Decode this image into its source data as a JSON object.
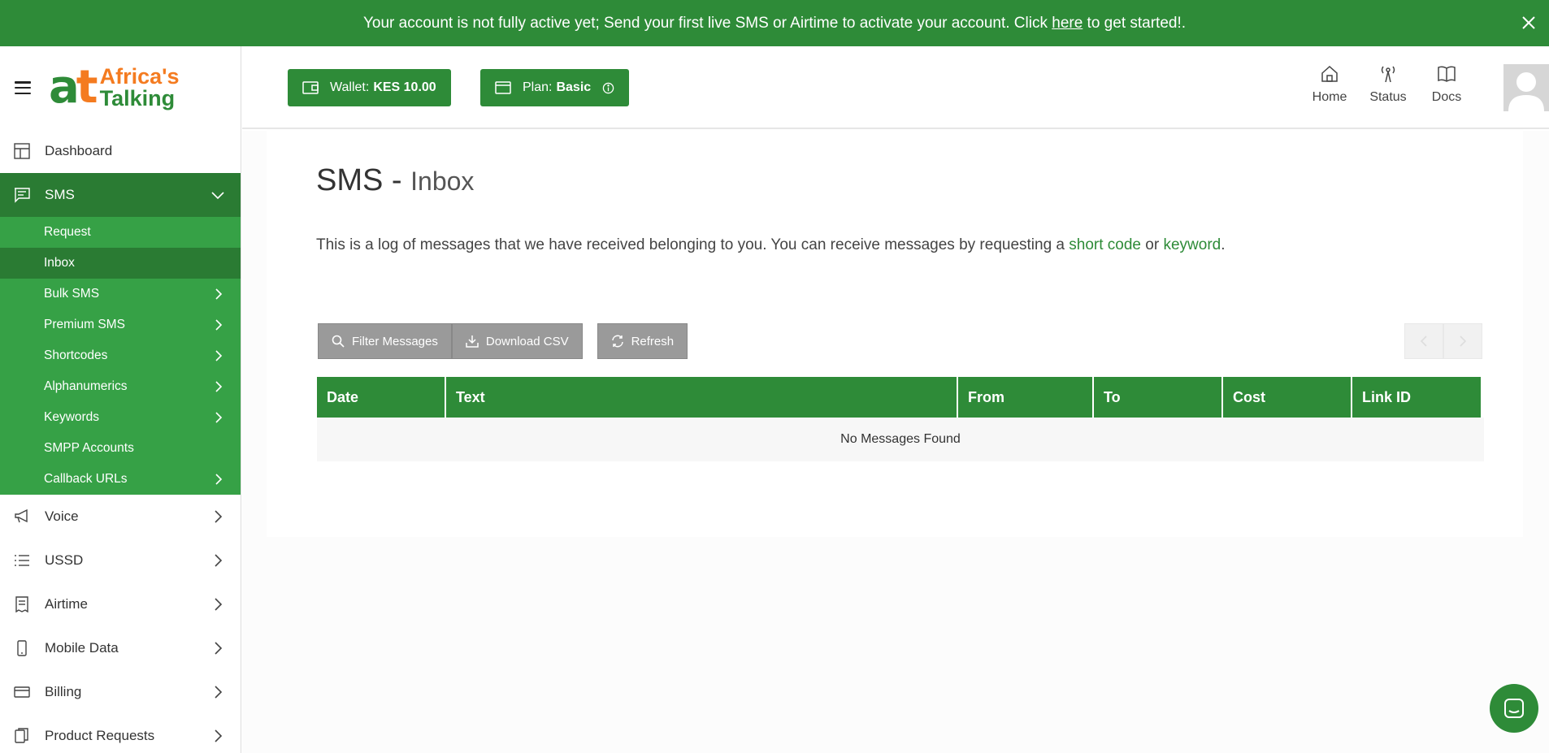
{
  "banner": {
    "text_before": "Your account is not fully active yet; Send your first live SMS or Airtime to activate your account. Click ",
    "link": "here",
    "text_after": " to get started!.",
    "close_icon": "close-icon"
  },
  "brand": {
    "logo_mark_a": "a",
    "logo_mark_t": "t",
    "name_line1": "Africa's",
    "name_line2": "Talking",
    "colors": {
      "green": "#2e8b38",
      "orange": "#f47b20",
      "submenu_green": "#36a146",
      "active_green": "#2a7b33"
    }
  },
  "sidebar": {
    "items_top": [
      {
        "label": "Dashboard",
        "icon": "dashboard-icon"
      },
      {
        "label": "SMS",
        "icon": "message-icon"
      }
    ],
    "sms_submenu": [
      {
        "label": "Request"
      },
      {
        "label": "Inbox"
      },
      {
        "label": "Bulk SMS"
      },
      {
        "label": "Premium SMS"
      },
      {
        "label": "Shortcodes"
      },
      {
        "label": "Alphanumerics"
      },
      {
        "label": "Keywords"
      },
      {
        "label": "SMPP Accounts"
      },
      {
        "label": "Callback URLs"
      }
    ],
    "items_bottom": [
      {
        "label": "Voice",
        "icon": "megaphone-icon"
      },
      {
        "label": "USSD",
        "icon": "list-icon"
      },
      {
        "label": "Airtime",
        "icon": "receipt-icon"
      },
      {
        "label": "Mobile Data",
        "icon": "phone-icon"
      },
      {
        "label": "Billing",
        "icon": "card-icon"
      },
      {
        "label": "Product Requests",
        "icon": "documents-icon"
      }
    ]
  },
  "topbar": {
    "wallet_prefix": "Wallet:",
    "wallet_value": "KES 10.00",
    "plan_prefix": "Plan:",
    "plan_value": "Basic",
    "links": [
      {
        "label": "Home",
        "icon": "home-icon"
      },
      {
        "label": "Status",
        "icon": "antenna-icon"
      },
      {
        "label": "Docs",
        "icon": "book-icon"
      }
    ]
  },
  "page": {
    "title": "SMS -",
    "subtitle": "Inbox",
    "description_before": "This is a log of messages that we have received belonging to you. You can receive messages by requesting a ",
    "link_shortcode": "short code",
    "description_mid": " or ",
    "link_keyword": "keyword",
    "description_after": "."
  },
  "toolbar": {
    "filter_label": "Filter Messages",
    "download_label": "Download CSV",
    "refresh_label": "Refresh"
  },
  "table": {
    "columns": [
      "Date",
      "Text",
      "From",
      "To",
      "Cost",
      "Link ID"
    ],
    "empty_message": "No Messages Found"
  }
}
